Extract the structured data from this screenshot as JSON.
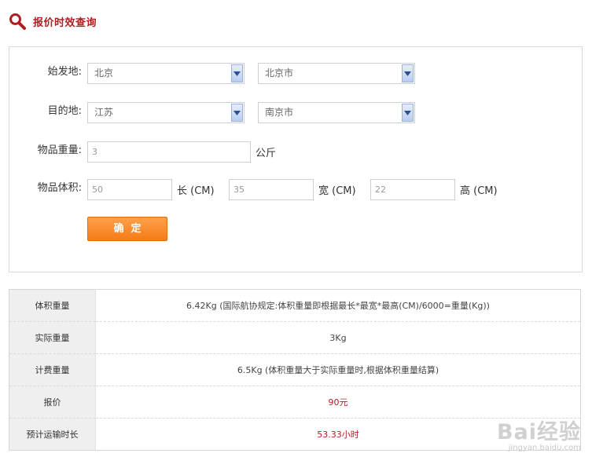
{
  "header": {
    "title": "报价时效查询",
    "accent_color": "#b01e23",
    "icon": "search-icon"
  },
  "form": {
    "origin": {
      "label": "始发地:",
      "province": "北京",
      "city": "北京市"
    },
    "destination": {
      "label": "目的地:",
      "province": "江苏",
      "city": "南京市"
    },
    "weight": {
      "label": "物品重量:",
      "value": "3",
      "unit": "公斤"
    },
    "volume": {
      "label": "物品体积:",
      "length": "50",
      "length_unit": "长 (CM)",
      "width": "35",
      "width_unit": "宽 (CM)",
      "height": "22",
      "height_unit": "高 (CM)"
    },
    "submit_label": "确定",
    "submit_color": "#f5891e"
  },
  "results": [
    {
      "key": "体积重量",
      "value": "6.42Kg (国际航协规定:体积重量即根据最长*最宽*最高(CM)/6000=重量(Kg))",
      "highlight": false
    },
    {
      "key": "实际重量",
      "value": "3Kg",
      "highlight": false
    },
    {
      "key": "计费重量",
      "value": "6.5Kg (体积重量大于实际重量时,根据体积重量结算)",
      "highlight": false
    },
    {
      "key": "报价",
      "value": "90元",
      "highlight": true
    },
    {
      "key": "预计运输时长",
      "value": "53.33小时",
      "highlight": true
    }
  ],
  "watermark": {
    "brand": "Bai经验",
    "url": "jingyan.baidu.com"
  }
}
